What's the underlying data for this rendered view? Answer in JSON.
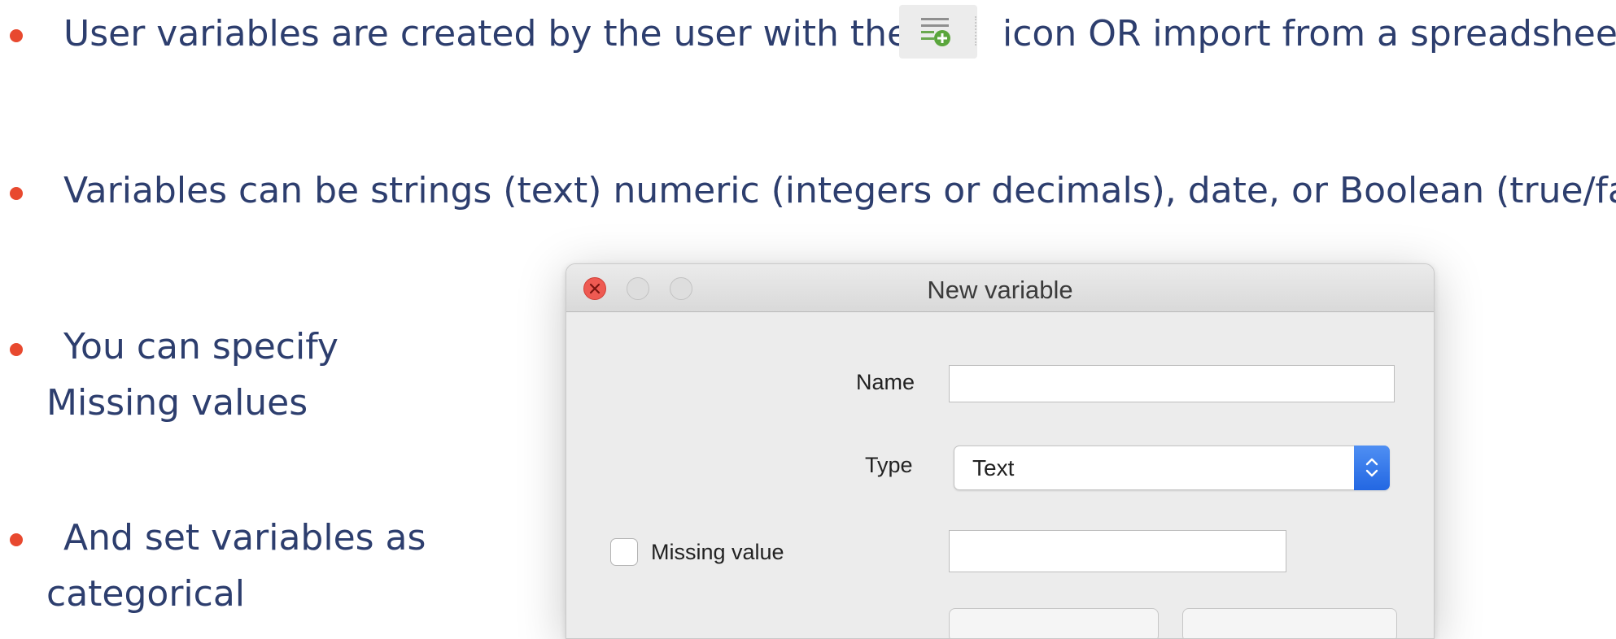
{
  "bullets": [
    {
      "text_before": "User variables are created by the user  with the",
      "icon": "add-variable-icon",
      "text_after": "icon OR import from a spreadsheet"
    },
    {
      "text": "Variables can be strings (text) numeric (integers or decimals), date, or Boolean (true/false)"
    },
    {
      "line1": "You can specify",
      "line2": "Missing values"
    },
    {
      "line1": "And set variables as",
      "line2": "categorical"
    }
  ],
  "dialog": {
    "title": "New variable",
    "name_label": "Name",
    "name_value": "",
    "type_label": "Type",
    "type_value": "Text",
    "missing_label": "Missing value",
    "missing_checked": false,
    "missing_value": ""
  },
  "colors": {
    "text": "#2d3e6e",
    "bullet": "#e8492f",
    "accent_blue": "#2367e2",
    "close_red": "#ee5a52",
    "icon_green": "#5aa63c"
  }
}
